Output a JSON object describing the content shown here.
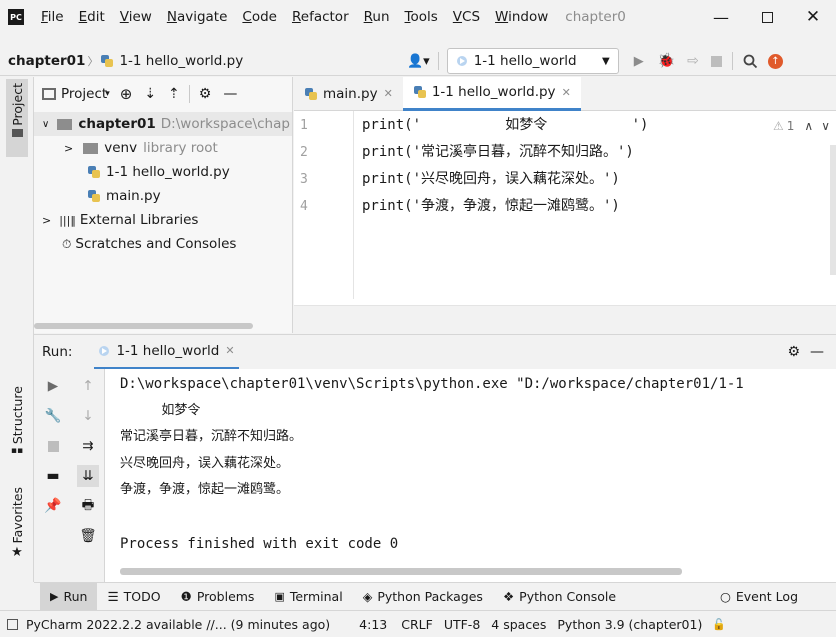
{
  "titlebar": {
    "menu": [
      "File",
      "Edit",
      "View",
      "Navigate",
      "Code",
      "Refactor",
      "Run",
      "Tools",
      "VCS",
      "Window"
    ],
    "project_name": "chapter0"
  },
  "navbar": {
    "breadcrumb_project": "chapter01",
    "breadcrumb_sep": "〉",
    "breadcrumb_file": "1-1 hello_world.py",
    "run_config": "1-1 hello_world"
  },
  "left_strip": {
    "project_tab": "Project",
    "structure_tab": "Structure",
    "favorites_tab": "Favorites"
  },
  "project_panel": {
    "title": "Project",
    "root_name": "chapter01",
    "root_path": "D:\\workspace\\chap",
    "venv": "venv",
    "venv_note": "library root",
    "file1": "1-1 hello_world.py",
    "file2": "main.py",
    "external": "External Libraries",
    "scratches": "Scratches and Consoles"
  },
  "editor": {
    "tab1": "main.py",
    "tab2": "1-1 hello_world.py",
    "warning_count": "1",
    "line_numbers": [
      "1",
      "2",
      "3",
      "4"
    ],
    "lines": [
      "print('          如梦令          ')",
      "print('常记溪亭日暮，沉醉不知归路。')",
      "print('兴尽晚回舟，误入藕花深处。')",
      "print('争渡，争渡，惊起一滩鸥鹭。')"
    ]
  },
  "run_panel": {
    "label": "Run:",
    "tab": "1-1 hello_world",
    "output": [
      "D:\\workspace\\chapter01\\venv\\Scripts\\python.exe \"D:/workspace/chapter01/1-1",
      "          如梦令",
      "常记溪亭日暮，沉醉不知归路。",
      "兴尽晚回舟，误入藕花深处。",
      "争渡，争渡，惊起一滩鸥鹭。",
      "",
      "Process finished with exit code 0"
    ]
  },
  "bottom_tabs": [
    "Run",
    "TODO",
    "Problems",
    "Terminal",
    "Python Packages",
    "Python Console",
    "Event Log"
  ],
  "status": {
    "message": "PyCharm 2022.2.2 available //... (9 minutes ago)",
    "position": "4:13",
    "line_sep": "CRLF",
    "encoding": "UTF-8",
    "indent": "4 spaces",
    "interpreter": "Python 3.9 (chapter01)"
  },
  "colors": {
    "python_blue": "#4a7fb5",
    "python_yellow": "#e8c350",
    "run_green": "#59a869",
    "accent": "#4083c9"
  }
}
